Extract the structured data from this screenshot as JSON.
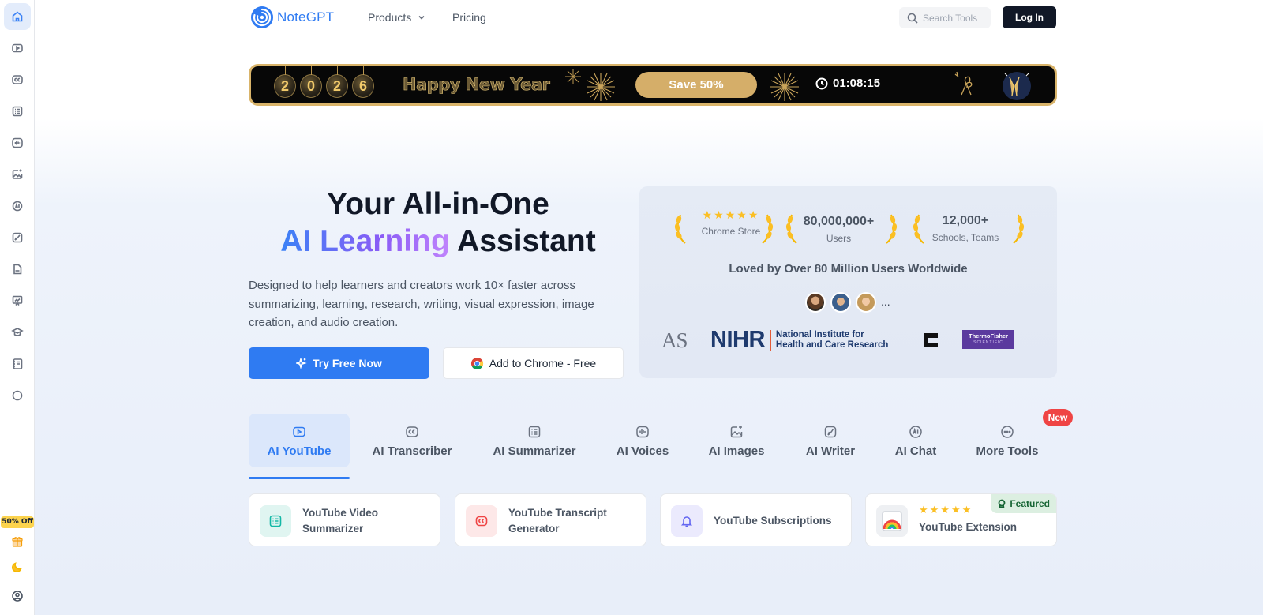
{
  "brand": {
    "name": "NoteGPT",
    "accent": "#2f7bf2"
  },
  "nav": {
    "products": "Products",
    "pricing": "Pricing",
    "search_placeholder": "Search Tools",
    "login": "Log In"
  },
  "sidebar": {
    "items": [
      "home-icon",
      "youtube-icon",
      "transcriber-icon",
      "summarizer-icon",
      "voices-icon",
      "images-icon",
      "ai-chat-icon",
      "writer-icon",
      "pdf-icon",
      "presentation-icon",
      "graduation-icon",
      "notebook-icon",
      "more-icon"
    ],
    "promo": "50% Off"
  },
  "banner": {
    "year_digits": [
      "2",
      "0",
      "2",
      "6"
    ],
    "greeting": "Happy New Year",
    "save": "Save 50%",
    "timer": "01:08:15"
  },
  "hero": {
    "title_line1": "Your All-in-One",
    "title_highlight": "AI Learning",
    "title_line2_end": " Assistant",
    "description": "Designed to help learners and creators work 10× faster across summarizing, learning, research, writing, visual expression, image creation, and audio creation.",
    "primary_cta": "Try Free Now",
    "secondary_cta": "Add to Chrome - Free"
  },
  "stats": {
    "chrome_store": {
      "stars": "★★★★★",
      "label": "Chrome Store"
    },
    "users": {
      "value": "80,000,000+",
      "label": "Users"
    },
    "schools": {
      "value": "12,000+",
      "label": "Schools, Teams"
    },
    "loved": "Loved by Over 80 Million Users Worldwide",
    "avatars_more": "...",
    "orgs": {
      "as": "AS",
      "nihr": "NIHR",
      "nihr_sub1": "National Institute for",
      "nihr_sub2": "Health and Care Research",
      "thermo1": "ThermoFisher",
      "thermo2": "SCIENTIFIC"
    }
  },
  "tabs": [
    {
      "label": "AI YouTube",
      "icon": "youtube-icon",
      "active": true
    },
    {
      "label": "AI Transcriber",
      "icon": "cc-icon"
    },
    {
      "label": "AI Summarizer",
      "icon": "list-icon"
    },
    {
      "label": "AI Voices",
      "icon": "waveform-icon"
    },
    {
      "label": "AI Images",
      "icon": "image-sparkle-icon"
    },
    {
      "label": "AI Writer",
      "icon": "feather-icon"
    },
    {
      "label": "AI Chat",
      "icon": "ai-bubble-icon"
    },
    {
      "label": "More Tools",
      "icon": "ellipsis-icon"
    }
  ],
  "new_badge": "New",
  "cards": [
    {
      "title": "YouTube Video Summarizer",
      "icon": "list-icon",
      "color": "#14b8a6"
    },
    {
      "title": "YouTube Transcript Generator",
      "icon": "cc-icon",
      "color": "#ef4444"
    },
    {
      "title": "YouTube Subscriptions",
      "icon": "bell-icon",
      "color": "#6366f1"
    },
    {
      "title": "YouTube Extension",
      "stars": "★★★★★",
      "badge": "Featured",
      "icon": "chrome-extension-icon"
    }
  ]
}
